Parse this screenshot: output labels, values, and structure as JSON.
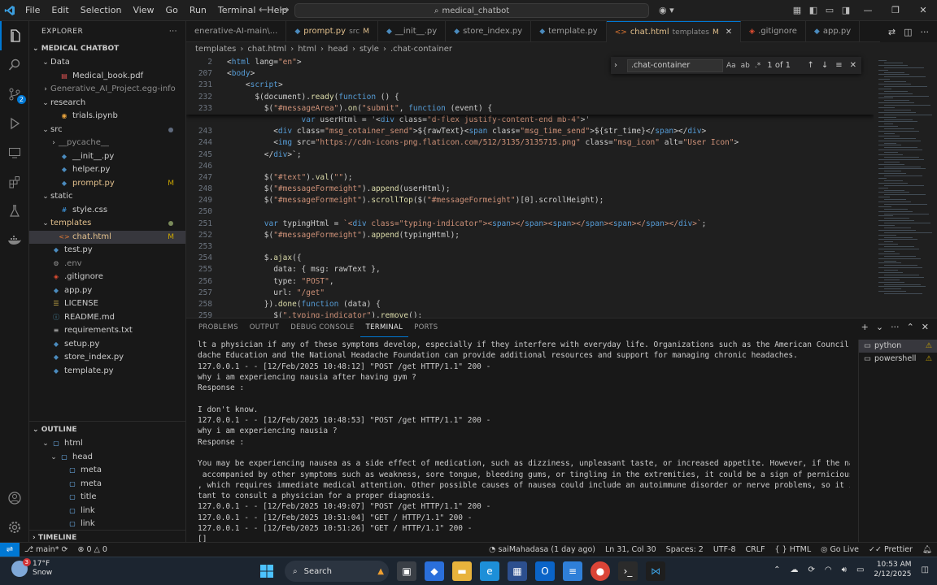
{
  "titlebar": {
    "menu": [
      "File",
      "Edit",
      "Selection",
      "View",
      "Go",
      "Run",
      "Terminal",
      "Help"
    ],
    "search": "medical_chatbot"
  },
  "activity_badges": {
    "source_control": "2"
  },
  "explorer": {
    "header": "EXPLORER",
    "project": "MEDICAL CHATBOT",
    "items": [
      {
        "name": "Data",
        "type": "folder-open",
        "indent": 1
      },
      {
        "name": "Medical_book.pdf",
        "type": "pdf",
        "indent": 2
      },
      {
        "name": "Generative_AI_Project.egg-info",
        "type": "folder",
        "indent": 1,
        "dim": true
      },
      {
        "name": "research",
        "type": "folder-open",
        "indent": 1
      },
      {
        "name": "trials.ipynb",
        "type": "notebook",
        "indent": 2
      },
      {
        "name": "src",
        "type": "folder-open",
        "indent": 1,
        "dot": true
      },
      {
        "name": "__pycache__",
        "type": "folder",
        "indent": 2,
        "dim": true
      },
      {
        "name": "__init__.py",
        "type": "python",
        "indent": 2
      },
      {
        "name": "helper.py",
        "type": "python",
        "indent": 2
      },
      {
        "name": "prompt.py",
        "type": "python",
        "indent": 2,
        "status": "M"
      },
      {
        "name": "static",
        "type": "folder-open",
        "indent": 1
      },
      {
        "name": "style.css",
        "type": "css",
        "indent": 2
      },
      {
        "name": "templates",
        "type": "folder-open",
        "indent": 1,
        "dot": true,
        "mod": true
      },
      {
        "name": "chat.html",
        "type": "html",
        "indent": 2,
        "status": "M",
        "selected": true
      },
      {
        "name": "test.py",
        "type": "python",
        "indent": 1
      },
      {
        "name": ".env",
        "type": "env",
        "indent": 1,
        "dim": true
      },
      {
        "name": ".gitignore",
        "type": "git",
        "indent": 1
      },
      {
        "name": "app.py",
        "type": "python",
        "indent": 1
      },
      {
        "name": "LICENSE",
        "type": "license",
        "indent": 1
      },
      {
        "name": "README.md",
        "type": "md",
        "indent": 1
      },
      {
        "name": "requirements.txt",
        "type": "txt",
        "indent": 1
      },
      {
        "name": "setup.py",
        "type": "python",
        "indent": 1
      },
      {
        "name": "store_index.py",
        "type": "python",
        "indent": 1
      },
      {
        "name": "template.py",
        "type": "python",
        "indent": 1
      }
    ]
  },
  "outline": {
    "header": "OUTLINE",
    "items": [
      {
        "name": "html",
        "indent": 1,
        "open": true
      },
      {
        "name": "head",
        "indent": 2,
        "open": true
      },
      {
        "name": "meta",
        "indent": 3
      },
      {
        "name": "meta",
        "indent": 3
      },
      {
        "name": "title",
        "indent": 3
      },
      {
        "name": "link",
        "indent": 3
      },
      {
        "name": "link",
        "indent": 3
      }
    ]
  },
  "timeline": {
    "header": "TIMELINE"
  },
  "tabs": [
    {
      "label": "enerative-AI-main\\...",
      "type": "",
      "icon": ""
    },
    {
      "label": "prompt.py",
      "meta": "src",
      "mod": "M",
      "icon": "py"
    },
    {
      "label": "__init__.py",
      "icon": "py"
    },
    {
      "label": "store_index.py",
      "icon": "py"
    },
    {
      "label": "template.py",
      "icon": "py"
    },
    {
      "label": "chat.html",
      "meta": "templates",
      "mod": "M",
      "icon": "html",
      "active": true
    },
    {
      "label": ".gitignore",
      "icon": "git"
    },
    {
      "label": "app.py",
      "icon": "py"
    }
  ],
  "breadcrumb": [
    "templates",
    "chat.html",
    "html",
    "head",
    "style",
    ".chat-container"
  ],
  "find": {
    "query": ".chat-container",
    "options": [
      "Aa",
      "ab",
      ".*"
    ],
    "count": "1 of 1"
  },
  "sticky_lines": [
    {
      "n": "2",
      "t": "<html lang=\"en\">"
    },
    {
      "n": "207",
      "t": "<body>"
    },
    {
      "n": "231",
      "t": "    <script>"
    },
    {
      "n": "232",
      "t": "      $(document).ready(function () {"
    },
    {
      "n": "233",
      "t": "        $(\"#messageArea\").on(\"submit\", function (event) {"
    }
  ],
  "code_lines": [
    {
      "n": "",
      "t": "                var userHtml = '<div class=\"d-flex justify-content-end mb-4\">'"
    },
    {
      "n": "243",
      "t": "          <div class=\"msg_cotainer_send\">${rawText}<span class=\"msg_time_send\">${str_time}</span></div>"
    },
    {
      "n": "244",
      "t": "          <img src=\"https://cdn-icons-png.flaticon.com/512/3135/3135715.png\" class=\"msg_icon\" alt=\"User Icon\">"
    },
    {
      "n": "245",
      "t": "        </div>`;"
    },
    {
      "n": "246",
      "t": ""
    },
    {
      "n": "247",
      "t": "        $(\"#text\").val(\"\");"
    },
    {
      "n": "248",
      "t": "        $(\"#messageFormeight\").append(userHtml);"
    },
    {
      "n": "249",
      "t": "        $(\"#messageFormeight\").scrollTop($(\"#messageFormeight\")[0].scrollHeight);"
    },
    {
      "n": "250",
      "t": ""
    },
    {
      "n": "251",
      "t": "        var typingHtml = `<div class=\"typing-indicator\"><span></span><span></span><span></span></div>`;"
    },
    {
      "n": "252",
      "t": "        $(\"#messageFormeight\").append(typingHtml);"
    },
    {
      "n": "253",
      "t": ""
    },
    {
      "n": "254",
      "t": "        $.ajax({"
    },
    {
      "n": "255",
      "t": "          data: { msg: rawText },"
    },
    {
      "n": "256",
      "t": "          type: \"POST\","
    },
    {
      "n": "257",
      "t": "          url: \"/get\""
    },
    {
      "n": "258",
      "t": "        }).done(function (data) {"
    },
    {
      "n": "259",
      "t": "          $(\".typing-indicator\").remove();"
    }
  ],
  "panel": {
    "tabs": [
      "PROBLEMS",
      "OUTPUT",
      "DEBUG CONSOLE",
      "TERMINAL",
      "PORTS"
    ],
    "active_tab": "TERMINAL",
    "terminal_lines": [
      "lt a physician if any of these symptoms develop, especially if they interfere with everyday life. Organizations such as the American Council for Hea",
      "dache Education and the National Headache Foundation can provide additional resources and support for managing chronic headaches.",
      "127.0.0.1 - - [12/Feb/2025 10:48:12] \"POST /get HTTP/1.1\" 200 -",
      "why i am experiencing nausia after having gym ?",
      "Response :",
      "",
      "I don't know.",
      "127.0.0.1 - - [12/Feb/2025 10:48:53] \"POST /get HTTP/1.1\" 200 -",
      "why i am experiencing nausia ?",
      "Response :",
      "",
      "You may be experiencing nausea as a side effect of medication, such as dizziness, unpleasant taste, or increased appetite. However, if the nausea is",
      " accompanied by other symptoms such as weakness, sore tongue, bleeding gums, or tingling in the extremities, it could be a sign of pernicious anemia",
      ", which requires immediate medical attention. Other possible causes of nausea could include an autoimmune disorder or nerve problems, so it is impor",
      "tant to consult a physician for a proper diagnosis.",
      "127.0.0.1 - - [12/Feb/2025 10:49:07] \"POST /get HTTP/1.1\" 200 -",
      "127.0.0.1 - - [12/Feb/2025 10:51:04] \"GET / HTTP/1.1\" 200 -",
      "127.0.0.1 - - [12/Feb/2025 10:51:26] \"GET / HTTP/1.1\" 200 -",
      "[]"
    ],
    "terminals": [
      {
        "name": "python",
        "selected": true
      },
      {
        "name": "powershell",
        "selected": false
      }
    ]
  },
  "statusbar": {
    "branch": "main*",
    "errors": "0",
    "warnings": "0",
    "author": "saiMahadasa (1 day ago)",
    "position": "Ln 31, Col 30",
    "spaces": "Spaces: 2",
    "encoding": "UTF-8",
    "eol": "CRLF",
    "language": "HTML",
    "golive": "Go Live",
    "prettier": "Prettier"
  },
  "taskbar": {
    "weather_temp": "17°F",
    "weather_desc": "Snow",
    "weather_badge": "3",
    "search": "Search",
    "time": "10:53 AM",
    "date": "2/12/2025"
  },
  "colors": {
    "accent": "#0078d4",
    "modified": "#e2c08d",
    "keyword": "#569cd6",
    "string": "#ce9178",
    "function": "#dcdcaa",
    "variable": "#9cdcfe",
    "tag": "#569cd6",
    "attr": "#9cdcfe"
  }
}
